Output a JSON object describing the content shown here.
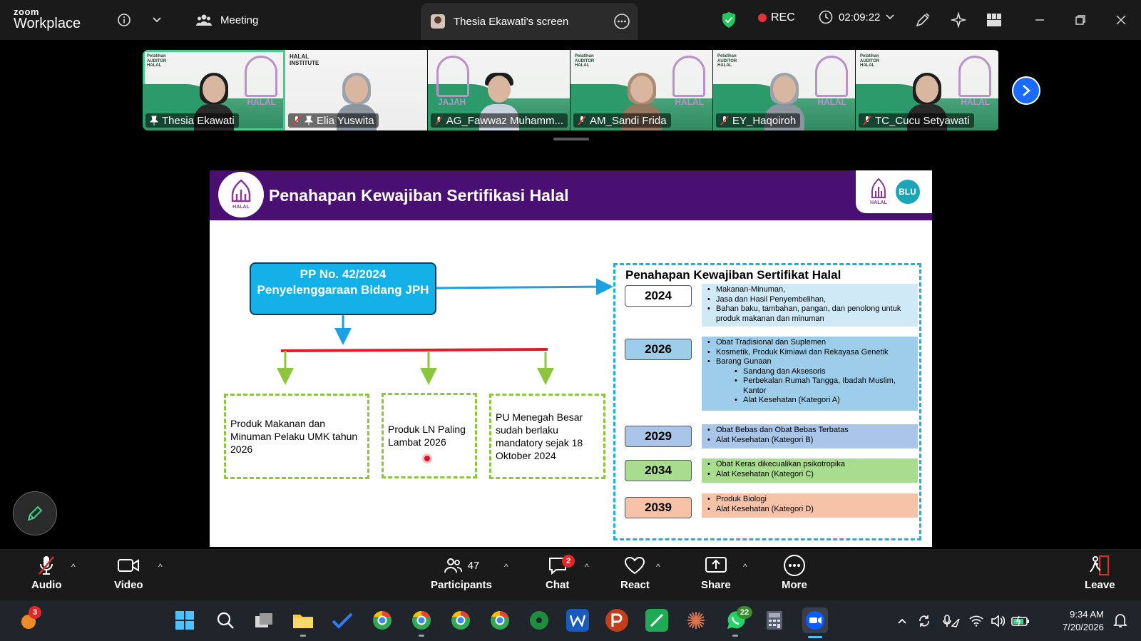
{
  "app": {
    "logo_line1": "zoom",
    "logo_line2": "Workplace"
  },
  "topbar": {
    "meeting_label": "Meeting",
    "share_tab_label": "Thesia Ekawati's screen",
    "rec_label": "REC",
    "timer": "02:09:22"
  },
  "participants_strip": [
    {
      "name": "Thesia Ekawati",
      "active": true
    },
    {
      "name": "Elia Yuswita",
      "active": false
    },
    {
      "name": "AG_Fawwaz Muhamm...",
      "active": false
    },
    {
      "name": "AM_Sandi Frida",
      "active": false
    },
    {
      "name": "EY_Haqoiroh",
      "active": false
    },
    {
      "name": "TC_Cucu Setyawati",
      "active": false
    }
  ],
  "tile_texts": {
    "halal": "HALAL",
    "auditor": "Pelatihan AUDITOR HALAL",
    "institute": "HALAL INSTITUTE",
    "jajah": "JAJAH"
  },
  "slide": {
    "title": "Penahapan Kewajiban Sertifikasi Halal",
    "logo_text": "HALAL",
    "blu_text": "BLU",
    "pp_box": "PP No. 42/2024 Penyelenggaraan Bidang JPH",
    "boxes": [
      "Produk Makanan dan Minuman Pelaku UMK tahun 2026",
      "Produk LN Paling Lambat 2026",
      "PU Menegah Besar sudah berlaku mandatory sejak 18 Oktober 2024"
    ],
    "panel_title": "Penahapan Kewajiban Sertifikat Halal",
    "phases": [
      {
        "year": "2024",
        "items": [
          "Makanan-Minuman,",
          "Jasa dan Hasil Penyembelihan,",
          "Bahan baku, tambahan, pangan, dan penolong untuk produk makanan dan minuman"
        ],
        "subitems": []
      },
      {
        "year": "2026",
        "items": [
          "Obat Tradisional dan Suplemen",
          "Kosmetik, Produk Kimiawi dan Rekayasa Genetik",
          "Barang Gunaan"
        ],
        "subitems": [
          "Sandang dan Aksesoris",
          "Perbekalan Rumah Tangga, Ibadah Muslim, Kantor",
          "Alat Kesehatan (Kategori A)"
        ]
      },
      {
        "year": "2029",
        "items": [
          "Obat Bebas dan Obat Bebas Terbatas",
          "Alat Kesehatan (Kategori B)"
        ],
        "subitems": []
      },
      {
        "year": "2034",
        "items": [
          "Obat Keras dikecualikan psikotropika",
          "Alat Kesehatan (Kategori C)"
        ],
        "subitems": []
      },
      {
        "year": "2039",
        "items": [
          "Produk Biologi",
          "Alat Kesehatan (Kategori D)"
        ],
        "subitems": []
      }
    ]
  },
  "toolbar": {
    "audio": "Audio",
    "video": "Video",
    "participants": "Participants",
    "participants_count": "47",
    "chat": "Chat",
    "chat_badge": "2",
    "react": "React",
    "share": "Share",
    "more": "More",
    "leave": "Leave"
  },
  "taskbar": {
    "notif_badge": "3",
    "whatsapp_badge": "22",
    "time": "9:34 AM",
    "date": "7/20/2026"
  },
  "colors": {
    "slide_header": "#4a0f73",
    "pp_box": "#14b0e8",
    "phase_2024": "#cfe9f7",
    "phase_2026": "#9dcde9",
    "phase_2029": "#a9c6e8",
    "phase_2034": "#a8dc8e",
    "phase_2039": "#f6c3a9",
    "rec_dot": "#e5313a"
  }
}
